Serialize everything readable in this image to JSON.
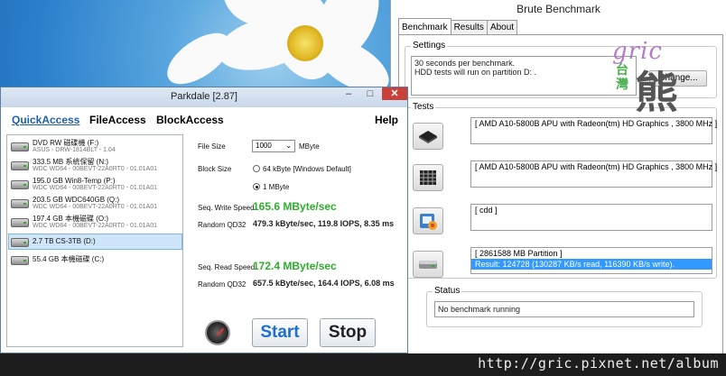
{
  "brute": {
    "title": "Brute Benchmark",
    "tabs": [
      "Benchmark",
      "Results",
      "About"
    ],
    "settings": {
      "group_label": "Settings",
      "line1": "30 seconds per benchmark.",
      "line2": "HDD tests will run on partition D: .",
      "change_label": "Change..."
    },
    "tests": {
      "group_label": "Tests",
      "items": [
        {
          "icon": "cpu-chip-icon",
          "lines": [
            "[ AMD A10-5800B APU with Radeon(tm) HD Graphics  , 3800 MHz ]"
          ]
        },
        {
          "icon": "cpu-grid-icon",
          "lines": [
            "[ AMD A10-5800B APU with Radeon(tm) HD Graphics  , 3800 MHz ]"
          ]
        },
        {
          "icon": "graphics-card-icon",
          "lines": [
            "[ cdd ]"
          ]
        },
        {
          "icon": "hard-disk-icon",
          "lines": [
            "[ 2861588 MB Partition ]",
            "Result: 124728 (130287 KB/s read, 116390 KB/s  write)."
          ]
        }
      ]
    },
    "status": {
      "group_label": "Status",
      "text": "No benchmark running"
    }
  },
  "watermark": {
    "gric": "gric",
    "tw": "台灣",
    "bear": "熊"
  },
  "parkdale": {
    "title": "Parkdale [2.87]",
    "controls": {
      "min": "–",
      "max": "□",
      "close": "✕"
    },
    "menu": {
      "quick": "QuickAccess",
      "file": "FileAccess",
      "block": "BlockAccess",
      "help": "Help"
    },
    "drives": [
      {
        "name": "DVD RW 磁碟機 (F:)",
        "model": "ASUS - DRW-1814BLT - 1.04"
      },
      {
        "name": "333.5 MB 系統保留 (N:)",
        "model": "WDC WD64 - 00BEVT-22A0RT0 - 01.01A01"
      },
      {
        "name": "195.0 GB Win8-Temp (P:)",
        "model": "WDC WD64 - 00BEVT-22A0RT0 - 01.01A01"
      },
      {
        "name": "203.5 GB WDC640GB (Q:)",
        "model": "WDC WD64 - 00BEVT-22A0RT0 - 01.01A01"
      },
      {
        "name": "197.4 GB 本機磁碟 (O:)",
        "model": "WDC WD64 - 00BEVT-22A0RT0 - 01.01A01"
      },
      {
        "name": "2.7 TB CS-3TB (D:)",
        "model": ""
      },
      {
        "name": "55.4 GB 本機磁碟 (C:)",
        "model": ""
      }
    ],
    "selected_drive": 5,
    "file_size_label": "File Size",
    "file_size_value": "1000",
    "file_size_unit": "MByte",
    "block_size_label": "Block Size",
    "block_option_1": "64 kByte [Windows Default]",
    "block_option_2": "1 MByte",
    "seq_write_label": "Seq. Write Speed",
    "seq_write_value": "165.6 MByte/sec",
    "random_write_label": "Random QD32",
    "random_write_value": "479.3 kByte/sec, 119.8 IOPS, 8.35 ms",
    "seq_read_label": "Seq. Read Speed",
    "seq_read_value": "172.4 MByte/sec",
    "random_read_label": "Random QD32",
    "random_read_value": "657.5 kByte/sec, 164.4 IOPS, 6.08 ms",
    "start_label": "Start",
    "stop_label": "Stop"
  },
  "url": "http://gric.pixnet.net/album"
}
